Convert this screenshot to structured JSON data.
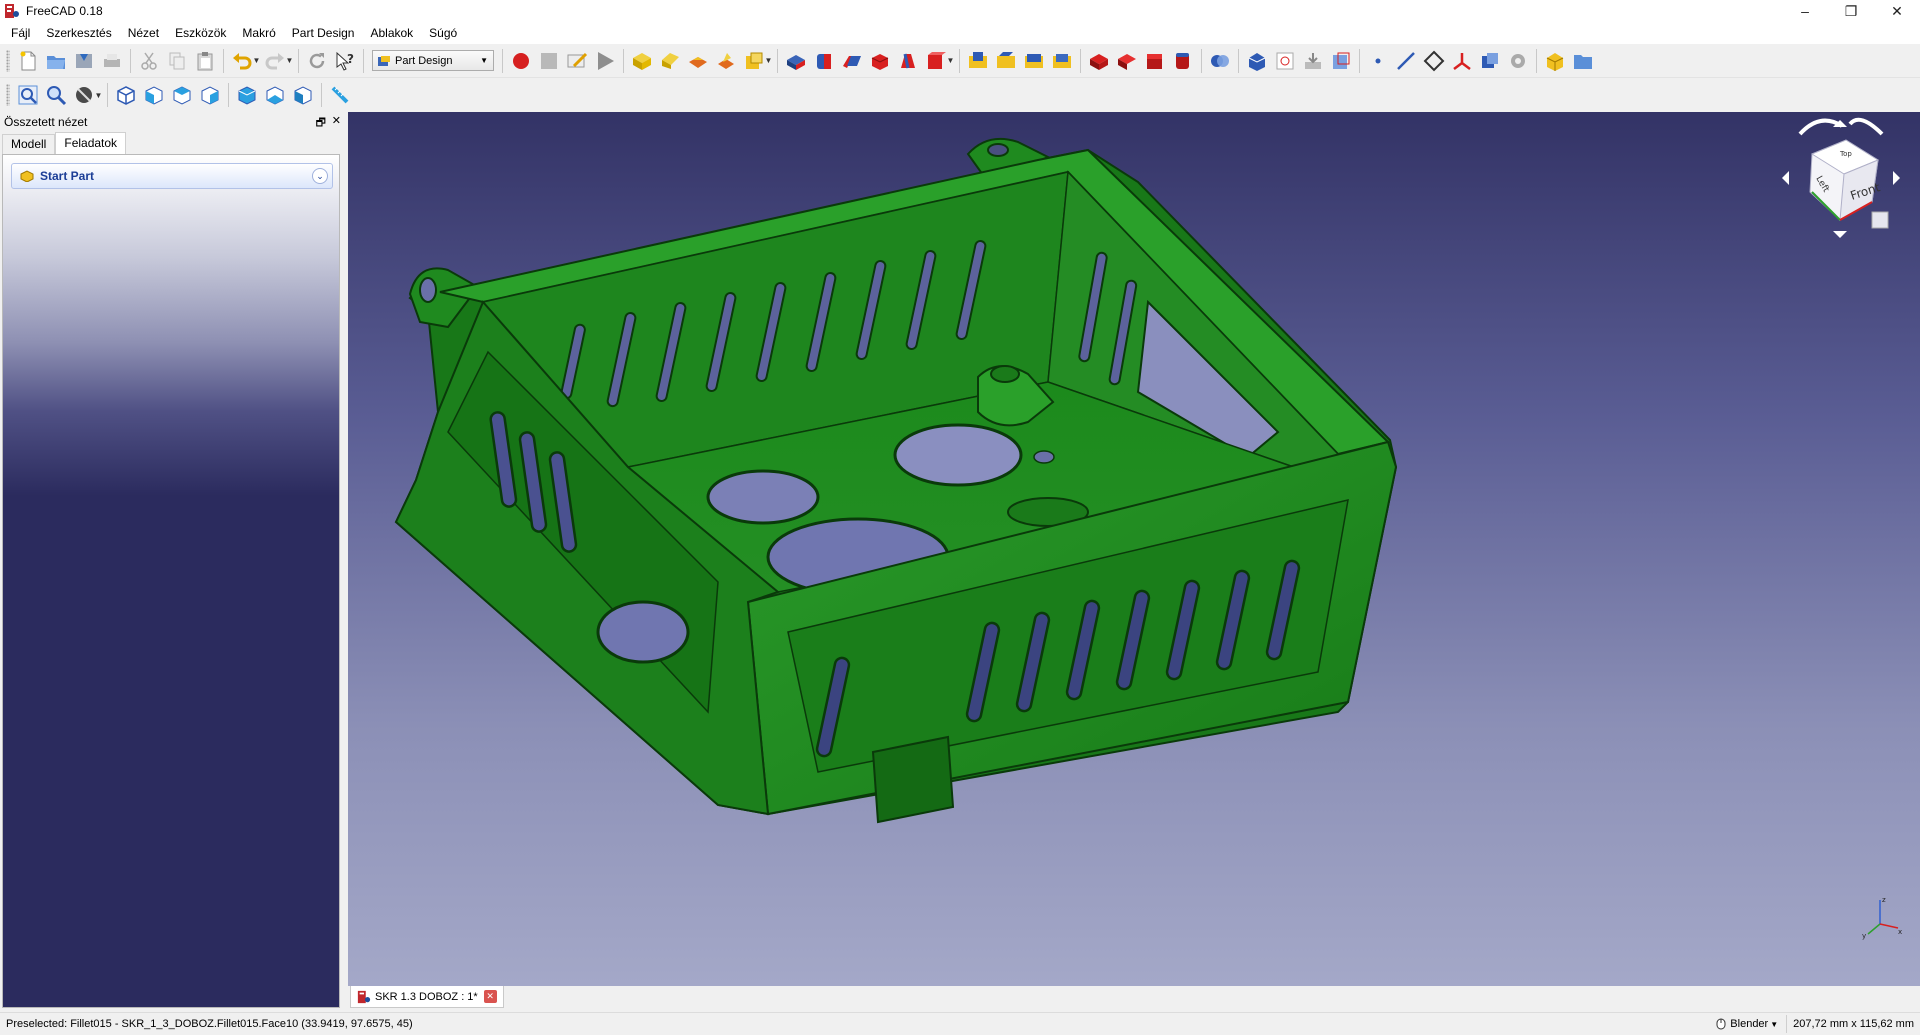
{
  "window": {
    "title": "FreeCAD 0.18",
    "controls": [
      "–",
      "❐",
      "✕"
    ]
  },
  "menu": [
    "Fájl",
    "Szerkesztés",
    "Nézet",
    "Eszközök",
    "Makró",
    "Part Design",
    "Ablakok",
    "Súgó"
  ],
  "toolbar": {
    "workbench": "Part Design"
  },
  "combo_view": {
    "title": "Összetett nézet",
    "tabs": [
      "Modell",
      "Feladatok"
    ],
    "active_tab": "Feladatok",
    "task": "Start Part"
  },
  "navcube": {
    "faces": [
      "Front",
      "Left",
      "Top"
    ]
  },
  "document_tab": {
    "label": "SKR 1.3 DOBOZ : 1*"
  },
  "statusbar": {
    "message": "Preselected: Fillet015 - SKR_1_3_DOBOZ.Fillet015.Face10 (33.9419, 97.6575, 45)",
    "nav_style": "Blender",
    "dimensions": "207,72 mm x 115,62 mm"
  },
  "colors": {
    "model_green": "#1e8a1e",
    "viewport_top": "#333366",
    "viewport_bottom": "#a4a8c8"
  }
}
